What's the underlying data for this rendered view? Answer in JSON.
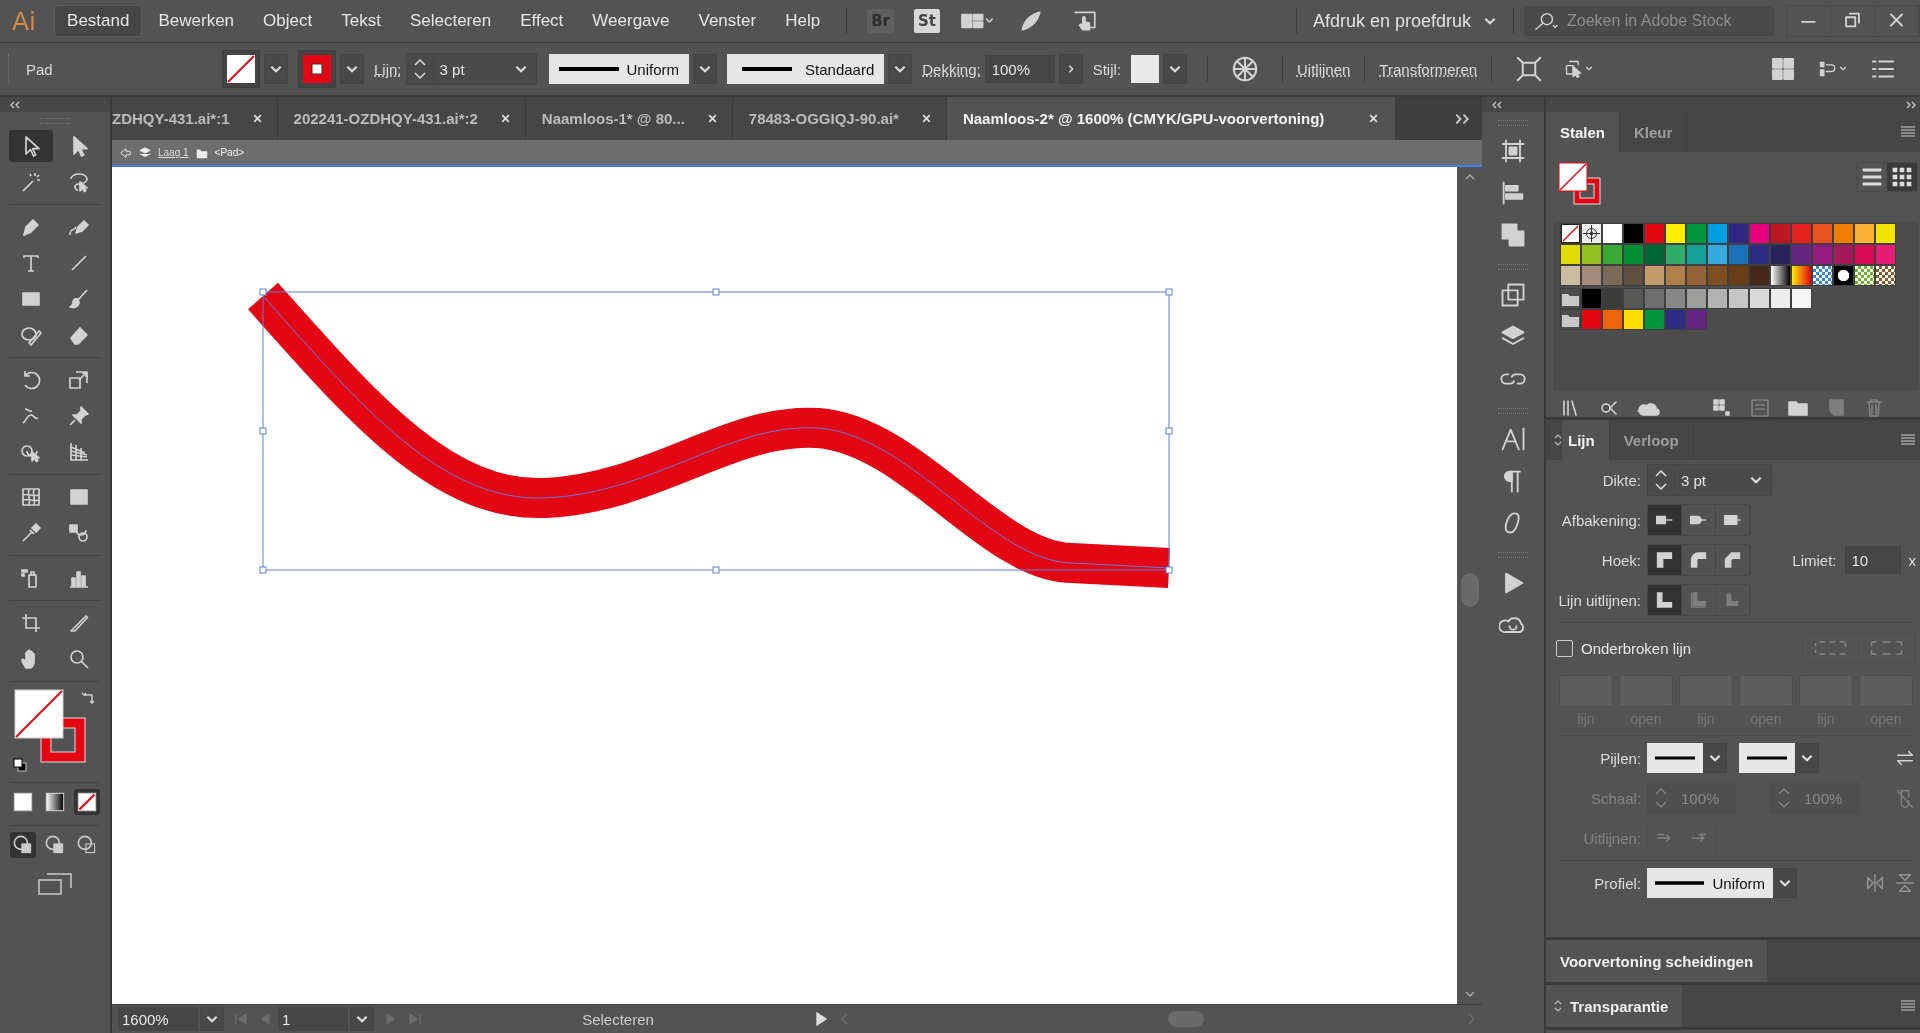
{
  "menu_bar": {
    "logo": "Ai",
    "items": [
      {
        "label": "Bestand",
        "selected": true
      },
      {
        "label": "Bewerken",
        "selected": false
      },
      {
        "label": "Object",
        "selected": false
      },
      {
        "label": "Tekst",
        "selected": false
      },
      {
        "label": "Selecteren",
        "selected": false
      },
      {
        "label": "Effect",
        "selected": false
      },
      {
        "label": "Weergave",
        "selected": false
      },
      {
        "label": "Venster",
        "selected": false
      },
      {
        "label": "Help",
        "selected": false
      }
    ],
    "bridge": "Br",
    "stock": "St",
    "workspace": "Afdruk en proefdruk",
    "search": {
      "placeholder": "Zoeken in Adobe Stock"
    }
  },
  "fill": {
    "kind": "none"
  },
  "stroke": {
    "color": "#e30613"
  },
  "graphic_style": {
    "color": "#e8e8e8"
  },
  "control_bar": {
    "object_type": "Pad",
    "stroke_label": "Lijn:",
    "stroke_weight": "3 pt",
    "profile": "Uniform",
    "brush": "Standaard",
    "opacity_label": "Dekking:",
    "opacity": "100%",
    "style_label": "Stijl:",
    "align": "Uitlijnen",
    "transform": "Transformeren"
  },
  "document_tabs": [
    {
      "title": "ZDHQY-431.ai*:1",
      "selected": false
    },
    {
      "title": "202241-OZDHQY-431.ai*:2",
      "selected": false
    },
    {
      "title": "Naamloos-1* @ 80...",
      "selected": false
    },
    {
      "title": "78483-OGGIQJ-90.ai*",
      "selected": false
    },
    {
      "title": "Naamloos-2* @ 1600% (CMYK/GPU-voorvertoning)",
      "selected": true
    }
  ],
  "breadcrumb": {
    "layer": "Laag 1",
    "object": "<Pad>"
  },
  "toolbar": {
    "tools": [
      {
        "selected": true
      },
      {
        "selected": false
      },
      {
        "selected": false
      },
      {
        "selected": false
      },
      {
        "selected": false
      },
      {
        "selected": false
      },
      {
        "selected": false
      },
      {
        "selected": false
      },
      {
        "selected": false
      },
      {
        "selected": false
      },
      {
        "selected": false
      },
      {
        "selected": false
      },
      {
        "selected": false
      },
      {
        "selected": false
      },
      {
        "selected": false
      },
      {
        "selected": false
      },
      {
        "selected": false
      },
      {
        "selected": false
      },
      {
        "selected": false
      },
      {
        "selected": false
      },
      {
        "selected": false
      },
      {
        "selected": false
      },
      {
        "selected": false
      },
      {
        "selected": false
      },
      {
        "selected": false
      },
      {
        "selected": false
      },
      {
        "selected": false
      },
      {
        "selected": false
      }
    ],
    "color_modes": [
      {
        "selected": false
      },
      {
        "selected": false
      },
      {
        "selected": true
      }
    ],
    "draw_modes": [
      {
        "selected": true
      },
      {
        "selected": false
      },
      {
        "selected": false
      }
    ]
  },
  "swatches_panel": {
    "tabs": [
      {
        "label": "Stalen",
        "selected": true
      },
      {
        "label": "Kleur",
        "selected": false
      }
    ],
    "views": [
      {
        "selected": false
      },
      {
        "selected": true
      }
    ],
    "rows": [
      {
        "swatches": [
          {
            "kind": "none"
          },
          {
            "kind": "registration"
          },
          {
            "kind": "color",
            "color": "#ffffff"
          },
          {
            "kind": "color",
            "color": "#000000"
          },
          {
            "kind": "color",
            "color": "#e30613"
          },
          {
            "kind": "color",
            "color": "#ffed00"
          },
          {
            "kind": "color",
            "color": "#009640"
          },
          {
            "kind": "color",
            "color": "#009fe3"
          },
          {
            "kind": "color",
            "color": "#312783"
          },
          {
            "kind": "color",
            "color": "#e6007e"
          },
          {
            "kind": "color",
            "color": "#be1622"
          },
          {
            "kind": "color",
            "color": "#e52421"
          },
          {
            "kind": "color",
            "color": "#e9531d"
          },
          {
            "kind": "color",
            "color": "#ef7d00"
          },
          {
            "kind": "color",
            "color": "#f9b233"
          },
          {
            "kind": "color",
            "color": "#f2e600"
          }
        ]
      },
      {
        "swatches": [
          {
            "kind": "color",
            "color": "#dedc00"
          },
          {
            "kind": "color",
            "color": "#95c11f"
          },
          {
            "kind": "color",
            "color": "#3aaa35"
          },
          {
            "kind": "color",
            "color": "#008d36"
          },
          {
            "kind": "color",
            "color": "#006633"
          },
          {
            "kind": "color",
            "color": "#2fac66"
          },
          {
            "kind": "color",
            "color": "#16a197"
          },
          {
            "kind": "color",
            "color": "#36a9e1"
          },
          {
            "kind": "color",
            "color": "#1d71b8"
          },
          {
            "kind": "color",
            "color": "#2d2e83"
          },
          {
            "kind": "color",
            "color": "#29235c"
          },
          {
            "kind": "color",
            "color": "#662483"
          },
          {
            "kind": "color",
            "color": "#951b81"
          },
          {
            "kind": "color",
            "color": "#a3195b"
          },
          {
            "kind": "color",
            "color": "#d60b52"
          },
          {
            "kind": "color",
            "color": "#e71d73"
          }
        ]
      },
      {
        "swatches": [
          {
            "kind": "color",
            "color": "#cbbba0"
          },
          {
            "kind": "color",
            "color": "#a48a7b"
          },
          {
            "kind": "color",
            "color": "#7b6a58"
          },
          {
            "kind": "color",
            "color": "#5f4e41"
          },
          {
            "kind": "color",
            "color": "#c49c6b"
          },
          {
            "kind": "color",
            "color": "#b17f4a"
          },
          {
            "kind": "color",
            "color": "#956136"
          },
          {
            "kind": "color",
            "color": "#7f4f21"
          },
          {
            "kind": "color",
            "color": "#693d15"
          },
          {
            "kind": "color",
            "color": "#452818"
          },
          {
            "kind": "gradient"
          },
          {
            "kind": "gradient"
          },
          {
            "kind": "pattern"
          },
          {
            "kind": "pattern"
          },
          {
            "kind": "pattern"
          },
          {
            "kind": "pattern"
          }
        ]
      },
      {
        "swatches": [
          {
            "kind": "folder"
          },
          {
            "kind": "color",
            "color": "#000000"
          },
          {
            "kind": "color",
            "color": "#3c3c3b"
          },
          {
            "kind": "color",
            "color": "#575756"
          },
          {
            "kind": "color",
            "color": "#706f6f"
          },
          {
            "kind": "color",
            "color": "#878787"
          },
          {
            "kind": "color",
            "color": "#9d9d9c"
          },
          {
            "kind": "color",
            "color": "#b2b2b2"
          },
          {
            "kind": "color",
            "color": "#c6c6c6"
          },
          {
            "kind": "color",
            "color": "#dadada"
          },
          {
            "kind": "color",
            "color": "#ededed"
          },
          {
            "kind": "color",
            "color": "#f6f6f6"
          }
        ]
      },
      {
        "swatches": [
          {
            "kind": "folder"
          },
          {
            "kind": "color",
            "color": "#e30613"
          },
          {
            "kind": "color",
            "color": "#ec6608"
          },
          {
            "kind": "color",
            "color": "#ffdd00"
          },
          {
            "kind": "color",
            "color": "#009640"
          },
          {
            "kind": "color",
            "color": "#2d2e83"
          },
          {
            "kind": "color",
            "color": "#662483"
          }
        ]
      }
    ],
    "actions": [
      {
        "disabled": false
      },
      {
        "disabled": false
      },
      {
        "disabled": false
      },
      {
        "disabled": false
      },
      {
        "disabled": true
      },
      {
        "disabled": false
      },
      {
        "disabled": true
      },
      {
        "disabled": true
      }
    ]
  },
  "stroke_panel": {
    "tabs": [
      {
        "label": "Lijn",
        "selected": true
      },
      {
        "label": "Verloop",
        "selected": false
      }
    ],
    "weight_label": "Dikte:",
    "weight": "3 pt",
    "cap_label": "Afbakening:",
    "caps": [
      {
        "selected": true
      },
      {
        "selected": false
      },
      {
        "selected": false
      }
    ],
    "corner_label": "Hoek:",
    "corners": [
      {
        "selected": true
      },
      {
        "selected": false
      },
      {
        "selected": false
      }
    ],
    "limit_label": "Limiet:",
    "limit": "10",
    "limit_unit": "x",
    "align_label": "Lijn uitlijnen:",
    "aligns": [
      {
        "selected": true,
        "disabled": false
      },
      {
        "selected": false,
        "disabled": true
      },
      {
        "selected": false,
        "disabled": true
      }
    ],
    "dashed": {
      "label": "Onderbroken lijn",
      "checked": false
    },
    "dash_fields": [
      {
        "label": "lijn",
        "disabled": true
      },
      {
        "label": "open",
        "disabled": true
      },
      {
        "label": "lijn",
        "disabled": true
      },
      {
        "label": "open",
        "disabled": true
      },
      {
        "label": "lijn",
        "disabled": true
      },
      {
        "label": "open",
        "disabled": true
      }
    ],
    "arrows_label": "Pijlen:",
    "scale": {
      "label": "Schaal:",
      "disabled": true,
      "values": [
        "100%",
        "100%"
      ]
    },
    "arrow_align": {
      "label": "Uitlijnen:",
      "disabled": true
    },
    "profile_label": "Profiel:",
    "profile": "Uniform"
  },
  "collapsed_panels": [
    {
      "title": "Voorvertoning scheidingen",
      "kind": "tab"
    },
    {
      "title": "Transparantie",
      "kind": "header"
    }
  ],
  "status_bar": {
    "zoom": "1600%",
    "artboard": "1",
    "tool": "Selecteren"
  }
}
